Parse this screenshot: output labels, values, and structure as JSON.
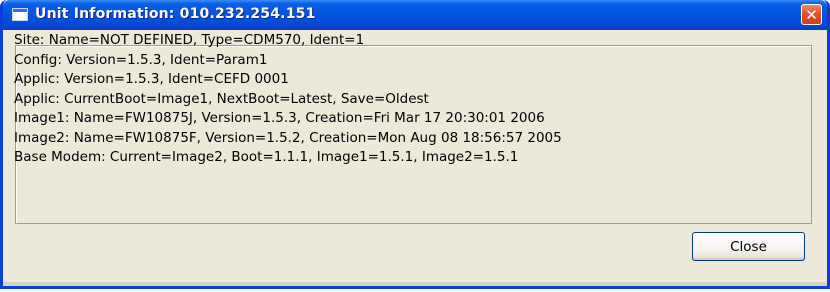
{
  "window": {
    "title": "Unit Information: 010.232.254.151",
    "close_glyph": "✕",
    "title_icon": "window-icon",
    "close_icon": "close-icon"
  },
  "content": {
    "lines": [
      "Site: Name=NOT DEFINED, Type=CDM570, Ident=1",
      "Config: Version=1.5.3, Ident=Param1",
      "Applic: Version=1.5.3, Ident=CEFD 0001",
      "Applic: CurrentBoot=Image1, NextBoot=Latest, Save=Oldest",
      "Image1: Name=FW10875J, Version=1.5.3, Creation=Fri Mar 17 20:30:01 2006",
      "Image2: Name=FW10875F, Version=1.5.2, Creation=Mon Aug 08 18:56:57 2005",
      "Base Modem: Current=Image2, Boot=1.1.1, Image1=1.5.1, Image2=1.5.1"
    ]
  },
  "buttons": {
    "close_label": "Close"
  },
  "colors": {
    "titlebar": "#0454e0",
    "window_face": "#ece9d8",
    "close_button_red": "#e0542c"
  }
}
